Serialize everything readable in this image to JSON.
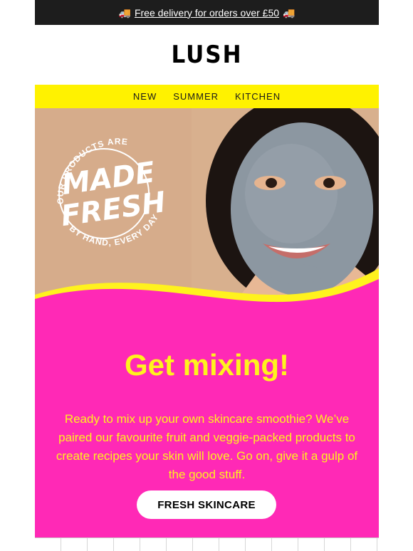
{
  "promo_bar": {
    "icon_left": "delivery-truck-icon",
    "icon_right": "delivery-truck-icon",
    "truck_glyph": "🚚",
    "link_text": "Free delivery for orders over £50"
  },
  "brand": {
    "logo_text": "LUSH"
  },
  "nav": {
    "items": [
      {
        "label": "NEW"
      },
      {
        "label": "SUMMER"
      },
      {
        "label": "KITCHEN"
      }
    ]
  },
  "hero": {
    "badge_top": "OUR PRODUCTS ARE",
    "badge_line1": "MADE",
    "badge_line2": "FRESH",
    "badge_bottom": "BY HAND, EVERY DAY"
  },
  "main": {
    "headline": "Get mixing!",
    "body": "Ready to mix up your own skincare smoothie? We’ve paired our favourite fruit and veggie-packed products to create recipes your skin will love. Go on, give it a gulp of the good stuff.",
    "cta_label": "FRESH SKINCARE"
  },
  "colors": {
    "topbar_bg": "#1d1d1d",
    "nav_bg": "#fff200",
    "accent_pink": "#ff29b6",
    "accent_yellow": "#fff21e",
    "cta_bg": "#ffffff"
  }
}
